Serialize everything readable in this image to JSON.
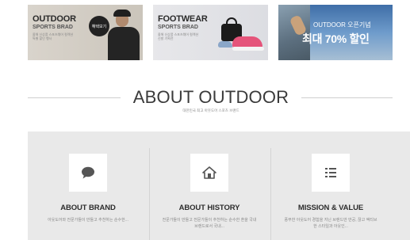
{
  "banners": [
    {
      "title": "OUTDOOR",
      "subtitle": "SPORTS BRAD",
      "small": "올해 신상품 스포츠웨어 컬렉션 특별 할인 행사",
      "badge": "혜택보기"
    },
    {
      "title": "FOOTWEAR",
      "subtitle": "SPORTS BRAD",
      "small": "올해 신상품 스포츠웨어 컬렉션 신발 기획전"
    },
    {
      "title": "OUTDOOR 오픈기념",
      "big": "최대 70% 할인"
    }
  ],
  "section": {
    "title": "ABOUT OUTDOOR",
    "subtitle": "대한민국 최고 아웃도어 스포츠 브랜드"
  },
  "columns": [
    {
      "icon": "speech-bubble-icon",
      "title": "ABOUT BRAND",
      "desc": "아웃도어와 전문가들이 만들고 추천하는 순수한..."
    },
    {
      "icon": "home-icon",
      "title": "ABOUT HISTORY",
      "desc": "전문가들이 만들고 전문가들이 추천하는 순수한 혼을 국내 브랜드로서 국내..."
    },
    {
      "icon": "list-icon",
      "title": "MISSION & VALUE",
      "desc": "풍부한 아웃도어 경험을 지닌 브랜드만 만공, 끊고 액티브한 스타일과 아웃인..."
    }
  ],
  "colors": {
    "info_bg": "#e9e9e9",
    "title": "#3a3a3a"
  }
}
